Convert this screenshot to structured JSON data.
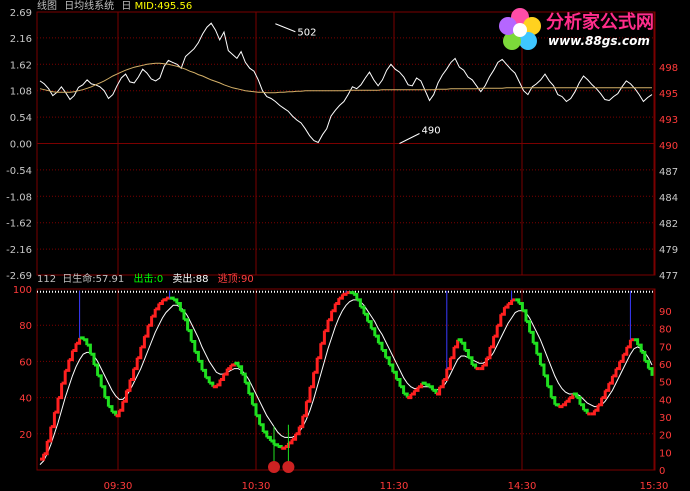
{
  "top_header": {
    "items": [
      {
        "text": "线图",
        "color": "#c0c0c0"
      },
      {
        "text": "日均线系统",
        "color": "#c0c0c0"
      },
      {
        "text": "日",
        "color": "#c0c0c0"
      },
      {
        "text": "MID:495.56",
        "color": "#ffff00"
      }
    ]
  },
  "logo": {
    "title": "分析家公式网",
    "url": "www.88gs.com"
  },
  "bottom_header": {
    "items": [
      {
        "text": "112",
        "color": "#c0c0c0"
      },
      {
        "text": "日生命:57.91",
        "color": "#c0c0c0"
      },
      {
        "text": "出击:0",
        "color": "#00ff00"
      },
      {
        "text": "卖出:88",
        "color": "#ffffff"
      },
      {
        "text": "逃顶:90",
        "color": "#ff4040"
      }
    ]
  },
  "colors": {
    "grid": "#7a0000",
    "axis_text": "#c8c8c8",
    "axis_text_right_top": "#ff3a3a",
    "accent_red": "#ff2020",
    "accent_green": "#20e020",
    "ma_line": "#d4b068"
  },
  "time_labels": [
    "09:30",
    "10:30",
    "11:30",
    "14:30",
    "15:30"
  ],
  "chart_data": [
    {
      "type": "line",
      "panel": "price",
      "left_axis_ticks": [
        "2.69",
        "2.16",
        "1.62",
        "1.08",
        "0.54",
        "0.00",
        "-0.54",
        "-1.08",
        "-1.62",
        "-2.16",
        "-2.69"
      ],
      "right_axis_ticks": [
        "498",
        "495",
        "493",
        "490",
        "487",
        "484",
        "482",
        "479",
        "477"
      ],
      "ylim": [
        -2.69,
        2.69
      ],
      "annotations": [
        {
          "label": "502",
          "x": 55,
          "y": 2.45
        },
        {
          "label": "490",
          "x": 84,
          "y": 0.0
        }
      ],
      "series": [
        {
          "color": "#ffffff",
          "values": [
            1.28,
            1.22,
            1.12,
            0.98,
            1.05,
            1.16,
            1.04,
            0.9,
            0.98,
            1.15,
            1.2,
            1.3,
            1.22,
            1.2,
            1.16,
            1.08,
            0.92,
            1.0,
            1.18,
            1.34,
            1.42,
            1.26,
            1.24,
            1.36,
            1.52,
            1.44,
            1.32,
            1.28,
            1.34,
            1.58,
            1.7,
            1.66,
            1.62,
            1.54,
            1.78,
            1.86,
            1.94,
            2.06,
            2.24,
            2.38,
            2.46,
            2.32,
            2.12,
            2.28,
            1.9,
            1.82,
            1.74,
            1.88,
            1.66,
            1.54,
            1.48,
            1.3,
            1.08,
            0.96,
            0.92,
            0.86,
            0.78,
            0.72,
            0.66,
            0.56,
            0.48,
            0.42,
            0.3,
            0.16,
            0.06,
            0.02,
            0.18,
            0.3,
            0.56,
            0.68,
            0.78,
            0.86,
            1.0,
            1.16,
            1.12,
            1.2,
            1.34,
            1.46,
            1.3,
            1.18,
            1.3,
            1.5,
            1.62,
            1.52,
            1.46,
            1.36,
            1.2,
            1.18,
            1.34,
            1.28,
            1.08,
            0.88,
            1.0,
            1.24,
            1.4,
            1.52,
            1.66,
            1.74,
            1.56,
            1.5,
            1.36,
            1.3,
            1.18,
            1.06,
            1.18,
            1.36,
            1.5,
            1.66,
            1.72,
            1.62,
            1.52,
            1.44,
            1.26,
            1.08,
            1.0,
            1.16,
            1.22,
            1.3,
            1.42,
            1.28,
            1.18,
            1.0,
            0.96,
            0.86,
            0.92,
            1.06,
            1.24,
            1.38,
            1.3,
            1.2,
            1.12,
            1.02,
            0.9,
            0.88,
            0.96,
            1.02,
            1.16,
            1.28,
            1.22,
            1.12,
            1.0,
            0.86,
            0.94,
            1.0
          ],
          "area_values": [
            1.28,
            1.2,
            1.08,
            0.96,
            1.02,
            1.12,
            1.0,
            0.9,
            0.94,
            1.1,
            1.18,
            1.28,
            1.2,
            1.18,
            1.12,
            1.02,
            0.9,
            0.98,
            1.14,
            1.32,
            1.4,
            1.24,
            1.22,
            1.34,
            1.5,
            1.42,
            1.3,
            1.26,
            1.3,
            1.56,
            1.68,
            1.64,
            1.6,
            1.5,
            1.74,
            1.84,
            1.92,
            2.02,
            2.2,
            2.36,
            2.44,
            2.3,
            2.1,
            2.26,
            1.86,
            1.78,
            1.72,
            1.86,
            1.62,
            1.5,
            1.44,
            1.26,
            1.04,
            0.92,
            0.88,
            0.82,
            0.74,
            0.68,
            0.62,
            0.52,
            0.44,
            0.38,
            0.26,
            0.12,
            0.02,
            0.0,
            0.14,
            0.26,
            0.52,
            0.64,
            0.74,
            0.82,
            0.96,
            1.12,
            1.08,
            1.16,
            1.3,
            1.42,
            1.26,
            1.14,
            1.26,
            1.46,
            1.58,
            1.48,
            1.42,
            1.32,
            1.16,
            1.14,
            1.3,
            1.24,
            1.04,
            0.84,
            0.96,
            1.2,
            1.36,
            1.48,
            1.62,
            1.7,
            1.52,
            1.46,
            1.32,
            1.26,
            1.14,
            1.02,
            1.14,
            1.32,
            1.46,
            1.62,
            1.68,
            1.58,
            1.48,
            1.4,
            1.22,
            1.04,
            0.96,
            1.12,
            1.18,
            1.26,
            1.38,
            1.24,
            1.14,
            0.96,
            0.92,
            0.82,
            0.88,
            1.02,
            1.2,
            1.34,
            1.26,
            1.16,
            1.08,
            0.98,
            0.86,
            0.84,
            0.92,
            0.98,
            1.12,
            1.24,
            1.18,
            1.08,
            0.96,
            0.82,
            0.9,
            0.96
          ]
        },
        {
          "color": "#d4b068",
          "values": [
            1.12,
            1.1,
            1.08,
            1.06,
            1.05,
            1.05,
            1.05,
            1.05,
            1.06,
            1.08,
            1.1,
            1.13,
            1.16,
            1.2,
            1.24,
            1.28,
            1.33,
            1.38,
            1.42,
            1.46,
            1.5,
            1.53,
            1.56,
            1.58,
            1.6,
            1.62,
            1.63,
            1.64,
            1.64,
            1.63,
            1.62,
            1.6,
            1.58,
            1.55,
            1.52,
            1.48,
            1.45,
            1.41,
            1.38,
            1.34,
            1.3,
            1.27,
            1.24,
            1.2,
            1.17,
            1.14,
            1.12,
            1.1,
            1.08,
            1.07,
            1.06,
            1.05,
            1.05,
            1.04,
            1.04,
            1.04,
            1.05,
            1.05,
            1.06,
            1.06,
            1.07,
            1.07,
            1.08,
            1.08,
            1.08,
            1.08,
            1.08,
            1.08,
            1.08,
            1.08,
            1.08,
            1.08,
            1.09,
            1.09,
            1.09,
            1.09,
            1.09,
            1.09,
            1.09,
            1.09,
            1.1,
            1.1,
            1.1,
            1.1,
            1.1,
            1.1,
            1.1,
            1.1,
            1.1,
            1.1,
            1.1,
            1.1,
            1.1,
            1.11,
            1.11,
            1.11,
            1.12,
            1.12,
            1.12,
            1.12,
            1.12,
            1.12,
            1.12,
            1.13,
            1.13,
            1.13,
            1.13,
            1.13,
            1.13,
            1.14,
            1.14,
            1.14,
            1.14,
            1.14,
            1.14,
            1.14,
            1.14,
            1.14,
            1.14,
            1.14,
            1.14,
            1.14,
            1.14,
            1.14,
            1.14,
            1.14,
            1.14,
            1.14,
            1.14,
            1.14,
            1.14,
            1.14,
            1.14,
            1.14,
            1.14,
            1.14,
            1.14,
            1.14,
            1.14,
            1.14,
            1.14,
            1.14,
            1.14,
            1.14
          ]
        }
      ]
    },
    {
      "type": "line",
      "panel": "indicator",
      "left_axis_ticks": [
        "100",
        "80",
        "60",
        "40",
        "20"
      ],
      "right_axis_ticks": [
        "90",
        "80",
        "70",
        "60",
        "50",
        "40",
        "30",
        "20",
        "10",
        "0"
      ],
      "ylim": [
        0,
        100
      ],
      "series": [
        {
          "name": "生命",
          "color_up": "#ff2020",
          "color_down": "#20e020",
          "values": [
            6,
            9,
            16,
            24,
            32,
            40,
            48,
            55,
            61,
            66,
            70,
            73,
            72,
            69,
            64,
            58,
            52,
            46,
            40,
            35,
            32,
            30,
            33,
            38,
            44,
            50,
            56,
            62,
            68,
            74,
            80,
            85,
            89,
            92,
            94,
            95,
            95,
            94,
            92,
            88,
            83,
            77,
            71,
            65,
            60,
            55,
            51,
            48,
            46,
            47,
            50,
            53,
            56,
            58,
            59,
            57,
            53,
            48,
            42,
            36,
            30,
            25,
            21,
            18,
            16,
            14,
            13,
            12,
            13,
            15,
            17,
            20,
            24,
            30,
            38,
            46,
            54,
            62,
            70,
            77,
            83,
            88,
            92,
            95,
            97,
            98,
            98,
            97,
            94,
            90,
            86,
            82,
            78,
            74,
            70,
            66,
            62,
            58,
            54,
            50,
            46,
            42,
            40,
            42,
            44,
            46,
            48,
            47,
            46,
            44,
            42,
            46,
            50,
            56,
            62,
            68,
            72,
            70,
            66,
            62,
            58,
            56,
            56,
            58,
            62,
            68,
            74,
            80,
            86,
            90,
            92,
            94,
            94,
            92,
            88,
            82,
            76,
            70,
            64,
            58,
            52,
            46,
            40,
            36,
            35,
            36,
            38,
            40,
            42,
            40,
            36,
            33,
            31,
            31,
            33,
            36,
            40,
            44,
            48,
            52,
            56,
            60,
            64,
            68,
            72,
            72,
            69,
            65,
            60,
            56,
            52
          ]
        },
        {
          "name": "signal",
          "color": "#ffffff",
          "values": [
            3,
            5,
            9,
            14,
            20,
            26,
            33,
            40,
            46,
            52,
            57,
            61,
            64,
            65,
            65,
            63,
            60,
            56,
            52,
            48,
            44,
            41,
            39,
            39,
            41,
            44,
            48,
            52,
            56,
            61,
            66,
            71,
            76,
            80,
            84,
            87,
            89,
            91,
            91,
            90,
            88,
            85,
            81,
            77,
            73,
            68,
            64,
            60,
            57,
            54,
            53,
            53,
            54,
            55,
            56,
            56,
            55,
            53,
            50,
            46,
            42,
            38,
            34,
            30,
            27,
            24,
            21,
            19,
            18,
            18,
            18,
            19,
            21,
            24,
            28,
            33,
            39,
            46,
            53,
            60,
            67,
            73,
            79,
            84,
            88,
            91,
            93,
            94,
            94,
            93,
            91,
            88,
            85,
            82,
            78,
            75,
            71,
            67,
            63,
            59,
            55,
            51,
            48,
            46,
            45,
            45,
            46,
            46,
            46,
            45,
            44,
            45,
            46,
            49,
            53,
            57,
            61,
            63,
            63,
            62,
            61,
            60,
            59,
            59,
            60,
            62,
            65,
            69,
            73,
            77,
            81,
            84,
            87,
            88,
            88,
            87,
            84,
            80,
            76,
            72,
            67,
            62,
            57,
            52,
            48,
            45,
            43,
            42,
            42,
            42,
            41,
            39,
            37,
            36,
            35,
            35,
            36,
            38,
            41,
            44,
            48,
            52,
            56,
            60,
            64,
            67,
            68,
            67,
            65,
            62,
            58
          ]
        }
      ]
    }
  ]
}
